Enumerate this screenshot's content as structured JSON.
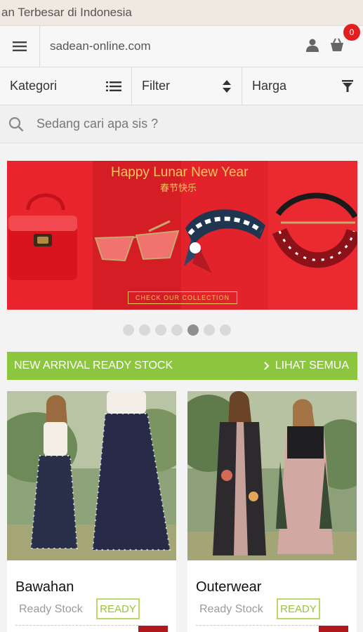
{
  "marquee": {
    "text": "an Terbesar di Indonesia"
  },
  "header": {
    "domain": "sadean-online.com",
    "cart_count": "0",
    "icons": {
      "menu": "hamburger-icon",
      "user": "user-icon",
      "cart": "cart-icon"
    }
  },
  "filters": {
    "kategori": "Kategori",
    "filter": "Filter",
    "harga": "Harga",
    "icons": {
      "kategori": "list-icon",
      "filter": "sort-icon",
      "harga": "funnel-icon"
    }
  },
  "search": {
    "placeholder": "Sedang cari apa sis ?",
    "icon": "search-icon"
  },
  "banner": {
    "title": "Happy Lunar New Year",
    "subtitle": "春节快乐",
    "cta": "CHECK OUR COLLECTION",
    "dots_total": 7,
    "active_dot": 5
  },
  "section": {
    "title": "NEW ARRIVAL READY STOCK",
    "see_all": "LIHAT SEMUA",
    "color": "#8cc63f"
  },
  "products": [
    {
      "name": "Bawahan",
      "stock": "Ready Stock",
      "badge": "READY"
    },
    {
      "name": "Outerwear",
      "stock": "Ready Stock",
      "badge": "READY"
    }
  ],
  "colors": {
    "accent_red": "#e31e1e",
    "ready_green": "#9ac23c",
    "banner_gold": "#f6c65b"
  }
}
